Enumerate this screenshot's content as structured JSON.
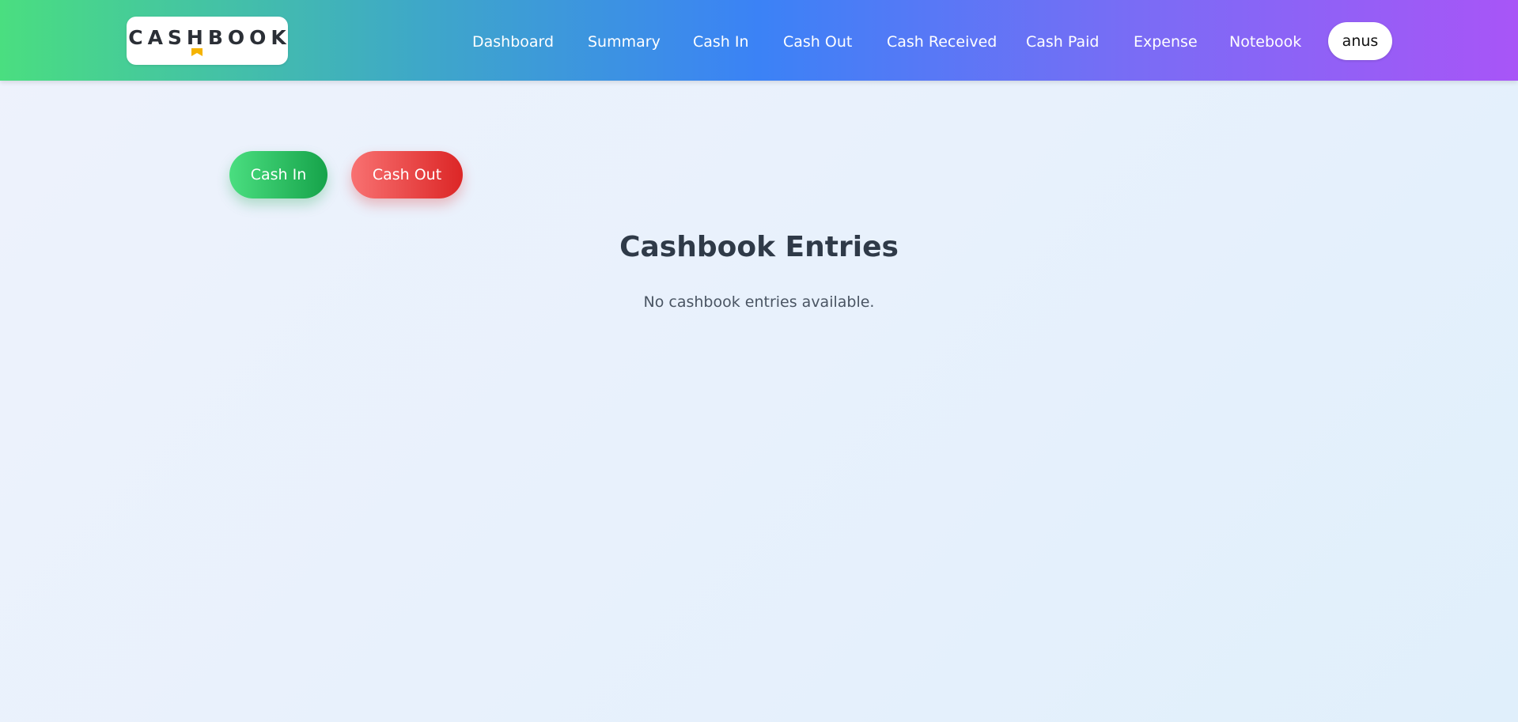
{
  "brand": {
    "logo_text": "CASHBOOK",
    "logo_mark_icon": "bookmark-icon",
    "logo_mark_color": "#f5b301"
  },
  "nav": {
    "items": [
      {
        "label": "Dashboard"
      },
      {
        "label": "Summary"
      },
      {
        "label": "Cash In"
      },
      {
        "label": "Cash Out"
      },
      {
        "label": "Cash Received"
      },
      {
        "label": "Cash Paid"
      },
      {
        "label": "Expense"
      },
      {
        "label": "Notebook"
      }
    ],
    "user_label": "anus"
  },
  "actions": {
    "cash_in_label": "Cash In",
    "cash_out_label": "Cash Out"
  },
  "main": {
    "title": "Cashbook Entries",
    "empty_message": "No cashbook entries available."
  },
  "colors": {
    "header_gradient": [
      "#4ade80",
      "#3b82f6",
      "#a855f7"
    ],
    "cash_in": "#16a34a",
    "cash_out": "#dc2626"
  }
}
